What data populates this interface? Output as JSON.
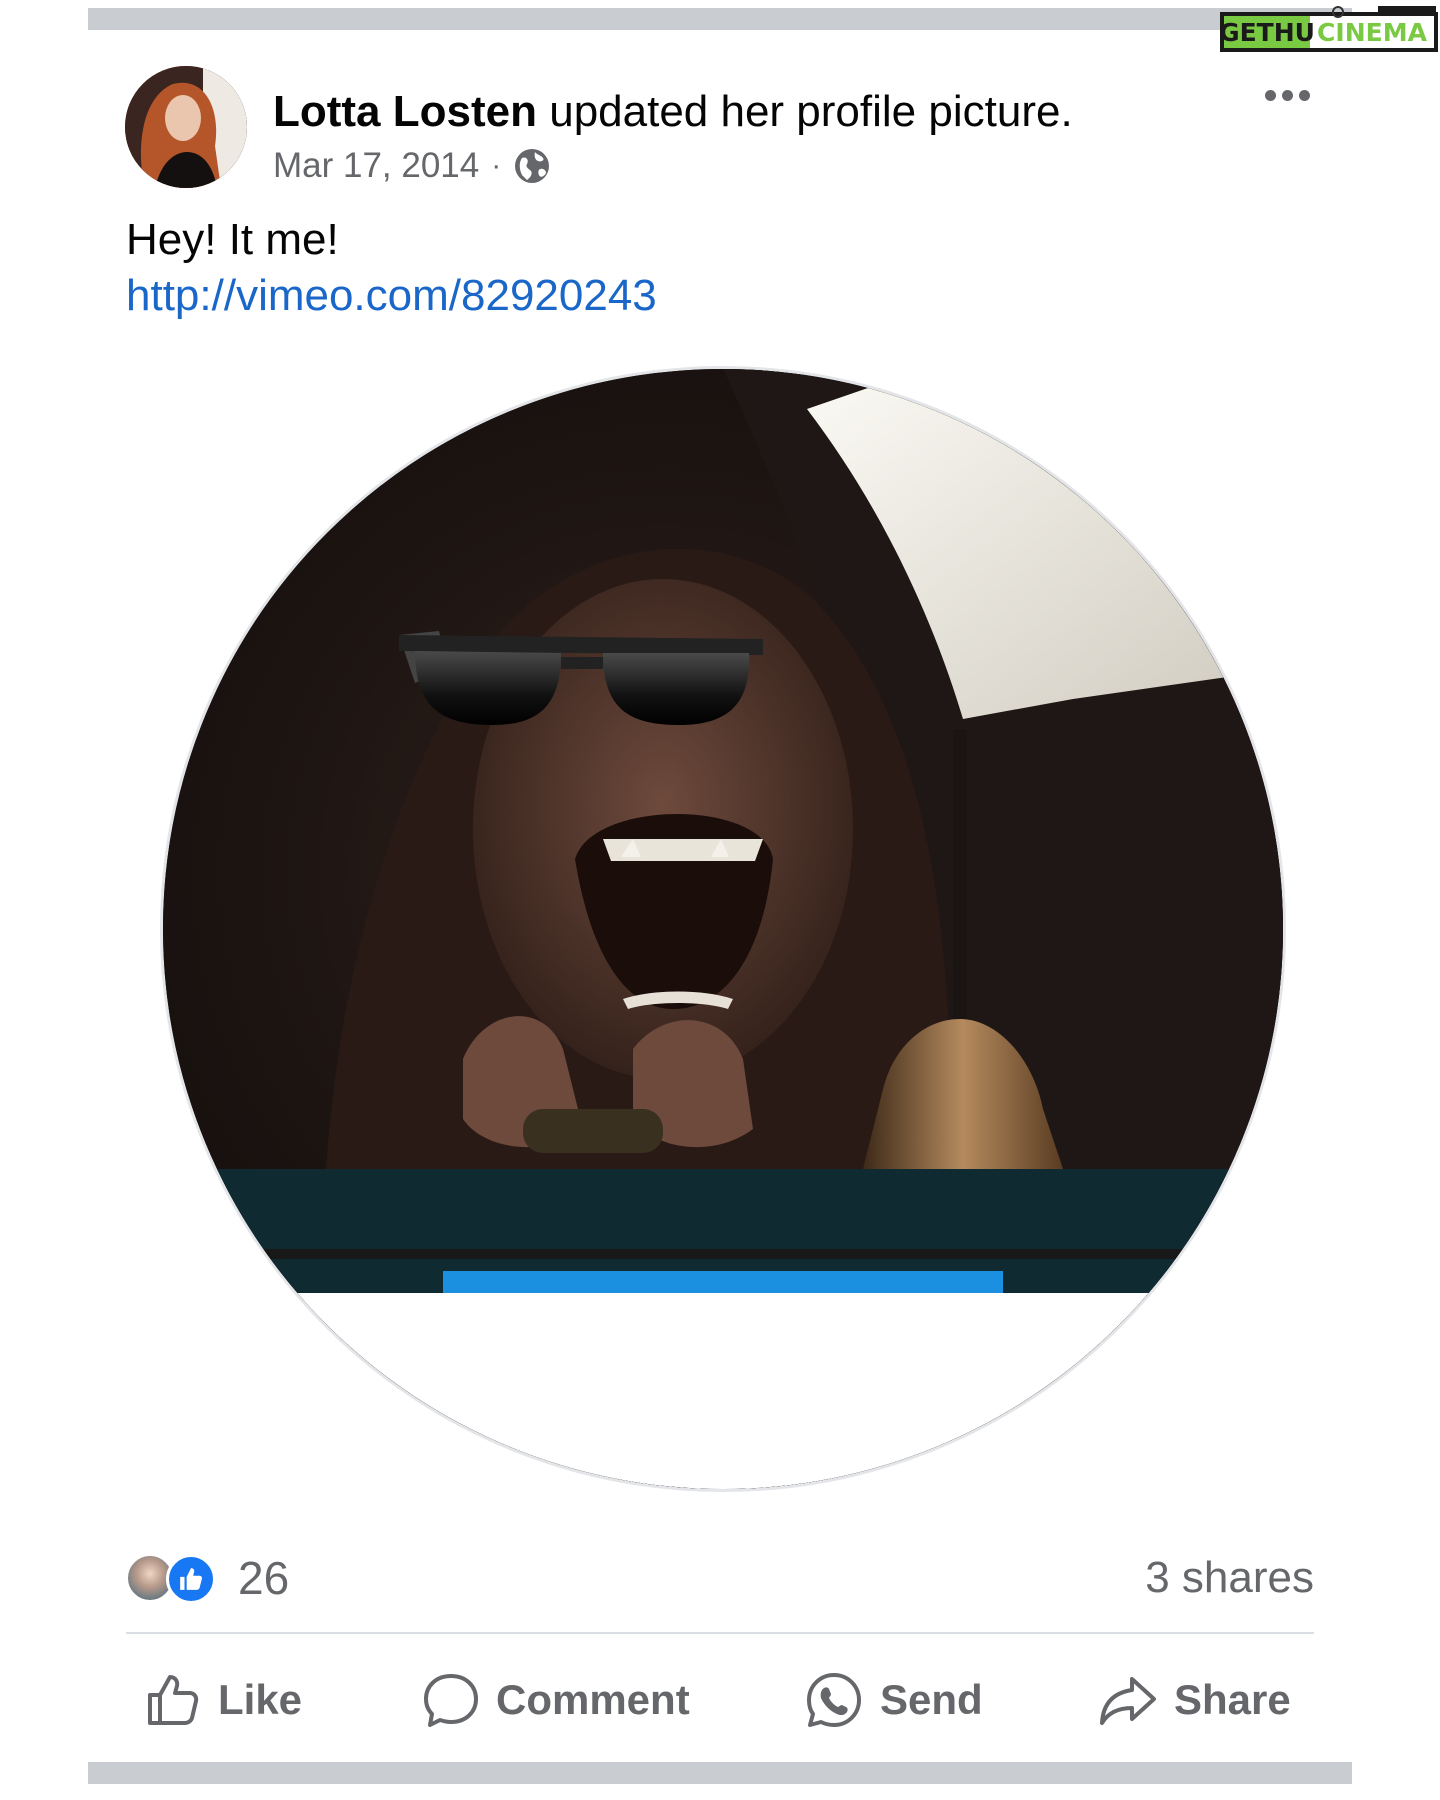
{
  "watermark": {
    "part1": "GETHU",
    "part2": "CINEMA"
  },
  "post": {
    "author": "Lotta Losten",
    "action_text": "updated her profile picture.",
    "date": "Mar 17, 2014",
    "separator": "·",
    "audience_icon": "globe-icon",
    "more_icon": "more-options-icon",
    "caption": "Hey! It me!",
    "link": "http://vimeo.com/82920243"
  },
  "stats": {
    "reaction_count": "26",
    "shares": "3 shares"
  },
  "actions": {
    "like": "Like",
    "comment": "Comment",
    "send": "Send",
    "share": "Share"
  },
  "colors": {
    "link": "#1a66c9",
    "meta_text": "#65676b",
    "like_blue": "#1877f2",
    "watermark_green": "#7ac943"
  }
}
